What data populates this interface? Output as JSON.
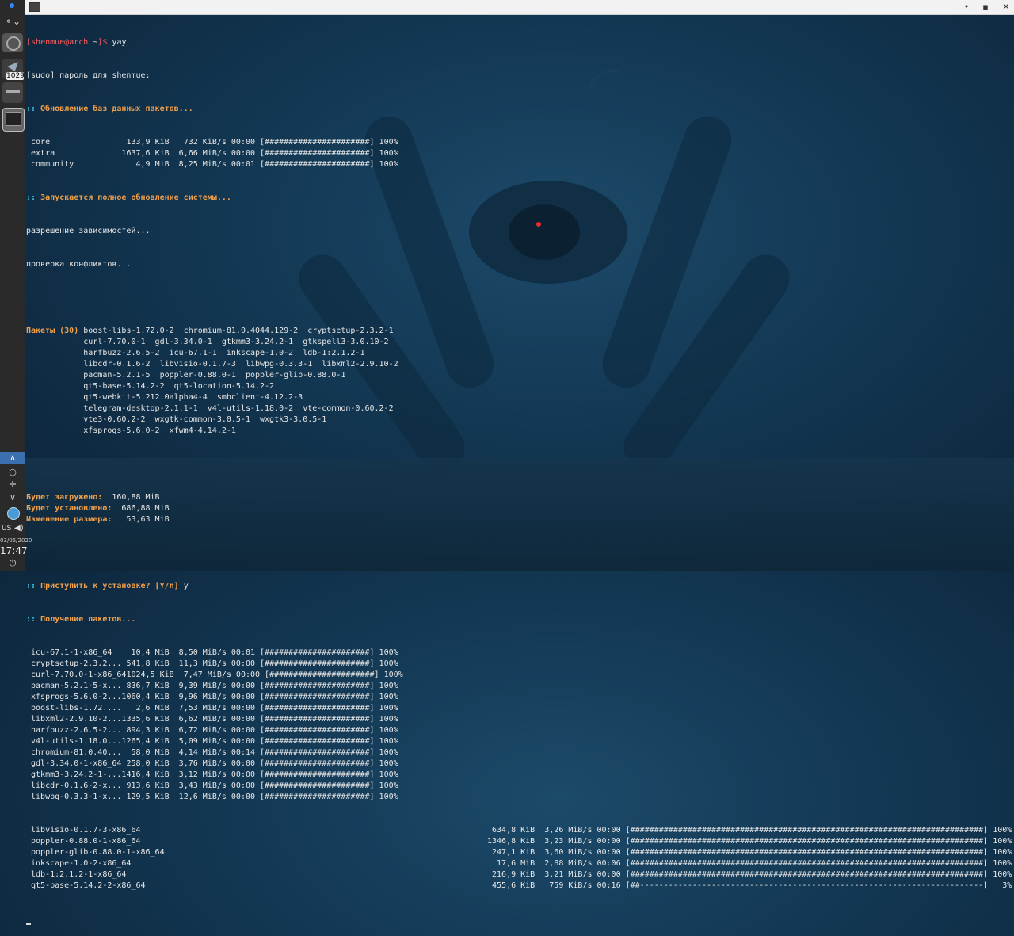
{
  "prompt": {
    "user_host": "shenmue@arch",
    "dir": "~",
    "command": "yay"
  },
  "sudo_line": "[sudo] пароль для shenmue:",
  "sync": {
    "header": "Обновление баз данных пакетов...",
    "rows": [
      {
        "name": "core",
        "size": "133,9 KiB",
        "speed": "732 KiB/s",
        "time": "00:00",
        "bar": "[######################]",
        "pct": "100%"
      },
      {
        "name": "extra",
        "size": "1637,6 KiB",
        "speed": "6,66 MiB/s",
        "time": "00:00",
        "bar": "[######################]",
        "pct": "100%"
      },
      {
        "name": "community",
        "size": "4,9 MiB",
        "speed": "8,25 MiB/s",
        "time": "00:01",
        "bar": "[######################]",
        "pct": "100%"
      }
    ]
  },
  "upgrade_header": "Запускается полное обновление системы...",
  "deps_line": "разрешение зависимостей...",
  "conflicts_line": "проверка конфликтов...",
  "packages": {
    "label": "Пакеты (30)",
    "lines": [
      "boost-libs-1.72.0-2  chromium-81.0.4044.129-2  cryptsetup-2.3.2-1",
      "curl-7.70.0-1  gdl-3.34.0-1  gtkmm3-3.24.2-1  gtkspell3-3.0.10-2",
      "harfbuzz-2.6.5-2  icu-67.1-1  inkscape-1.0-2  ldb-1:2.1.2-1",
      "libcdr-0.1.6-2  libvisio-0.1.7-3  libwpg-0.3.3-1  libxml2-2.9.10-2",
      "pacman-5.2.1-5  poppler-0.88.0-1  poppler-glib-0.88.0-1",
      "qt5-base-5.14.2-2  qt5-location-5.14.2-2",
      "qt5-webkit-5.212.0alpha4-4  smbclient-4.12.2-3",
      "telegram-desktop-2.1.1-1  v4l-utils-1.18.0-2  vte-common-0.60.2-2",
      "vte3-0.60.2-2  wxgtk-common-3.0.5-1  wxgtk3-3.0.5-1",
      "xfsprogs-5.6.0-2  xfwm4-4.14.2-1"
    ]
  },
  "summary": [
    {
      "label": "Будет загружено:",
      "value": "160,88 MiB",
      "pad": "  "
    },
    {
      "label": "Будет установлено:",
      "value": "686,88 MiB",
      "pad": "  "
    },
    {
      "label": "Изменение размера:",
      "value": "53,63 MiB",
      "pad": "   "
    }
  ],
  "confirm": {
    "question": "Приступить к установке? [Y/n]",
    "answer": "y"
  },
  "fetch_header": "Получение пакетов...",
  "fetch_rows": [
    {
      "name": "icu-67.1-1-x86_64",
      "size": "10,4 MiB",
      "speed": "8,50 MiB/s",
      "time": "00:01",
      "bar": "[######################]",
      "pct": "100%"
    },
    {
      "name": "cryptsetup-2.3.2...",
      "size": "541,8 KiB",
      "speed": "11,3 MiB/s",
      "time": "00:00",
      "bar": "[######################]",
      "pct": "100%"
    },
    {
      "name": "curl-7.70.0-1-x86_64",
      "size": "1024,5 KiB",
      "speed": "7,47 MiB/s",
      "time": "00:00",
      "bar": "[######################]",
      "pct": "100%"
    },
    {
      "name": "pacman-5.2.1-5-x...",
      "size": "836,7 KiB",
      "speed": "9,39 MiB/s",
      "time": "00:00",
      "bar": "[######################]",
      "pct": "100%"
    },
    {
      "name": "xfsprogs-5.6.0-2...",
      "size": "1060,4 KiB",
      "speed": "9,96 MiB/s",
      "time": "00:00",
      "bar": "[######################]",
      "pct": "100%"
    },
    {
      "name": "boost-libs-1.72....",
      "size": "2,6 MiB",
      "speed": "7,53 MiB/s",
      "time": "00:00",
      "bar": "[######################]",
      "pct": "100%"
    },
    {
      "name": "libxml2-2.9.10-2...",
      "size": "1335,6 KiB",
      "speed": "6,62 MiB/s",
      "time": "00:00",
      "bar": "[######################]",
      "pct": "100%"
    },
    {
      "name": "harfbuzz-2.6.5-2...",
      "size": "894,3 KiB",
      "speed": "6,72 MiB/s",
      "time": "00:00",
      "bar": "[######################]",
      "pct": "100%"
    },
    {
      "name": "v4l-utils-1.18.0...",
      "size": "1265,4 KiB",
      "speed": "5,09 MiB/s",
      "time": "00:00",
      "bar": "[######################]",
      "pct": "100%"
    },
    {
      "name": "chromium-81.0.40...",
      "size": "58,0 MiB",
      "speed": "4,14 MiB/s",
      "time": "00:14",
      "bar": "[######################]",
      "pct": "100%"
    },
    {
      "name": "gdl-3.34.0-1-x86_64",
      "size": "258,0 KiB",
      "speed": "3,76 MiB/s",
      "time": "00:00",
      "bar": "[######################]",
      "pct": "100%"
    },
    {
      "name": "gtkmm3-3.24.2-1-...",
      "size": "1416,4 KiB",
      "speed": "3,12 MiB/s",
      "time": "00:00",
      "bar": "[######################]",
      "pct": "100%"
    },
    {
      "name": "libcdr-0.1.6-2-x...",
      "size": "913,6 KiB",
      "speed": "3,43 MiB/s",
      "time": "00:00",
      "bar": "[######################]",
      "pct": "100%"
    },
    {
      "name": "libwpg-0.3.3-1-x...",
      "size": "129,5 KiB",
      "speed": "12,6 MiB/s",
      "time": "00:00",
      "bar": "[######################]",
      "pct": "100%"
    }
  ],
  "wide_rows": [
    {
      "name": "libvisio-0.1.7-3-x86_64",
      "size": "634,8 KiB",
      "speed": "3,26 MiB/s",
      "time": "00:00",
      "bar": "[##########################################################################]",
      "pct": "100%"
    },
    {
      "name": "poppler-0.88.0-1-x86_64",
      "size": "1346,8 KiB",
      "speed": "3,23 MiB/s",
      "time": "00:00",
      "bar": "[##########################################################################]",
      "pct": "100%"
    },
    {
      "name": "poppler-glib-0.88.0-1-x86_64",
      "size": "247,1 KiB",
      "speed": "3,60 MiB/s",
      "time": "00:00",
      "bar": "[##########################################################################]",
      "pct": "100%"
    },
    {
      "name": "inkscape-1.0-2-x86_64",
      "size": "17,6 MiB",
      "speed": "2,88 MiB/s",
      "time": "00:06",
      "bar": "[##########################################################################]",
      "pct": "100%"
    },
    {
      "name": "ldb-1:2.1.2-1-x86_64",
      "size": "216,9 KiB",
      "speed": "3,21 MiB/s",
      "time": "00:00",
      "bar": "[##########################################################################]",
      "pct": "100%"
    },
    {
      "name": "qt5-base-5.14.2-2-x86_64",
      "size": "455,6 KiB",
      "speed": "759 KiB/s",
      "time": "00:16",
      "bar": "[##------------------------------------------------------------------------]",
      "pct": "3%"
    }
  ],
  "panel": {
    "badge": "1029",
    "kb_layout": "US",
    "date": "03/05/2020",
    "time": "17:47"
  },
  "colors": {
    "prompt": "#ff5b5b",
    "header_marker": "#3fc6e0",
    "header_text": "#f0a04b",
    "terminal_text": "#e6e6e6"
  }
}
